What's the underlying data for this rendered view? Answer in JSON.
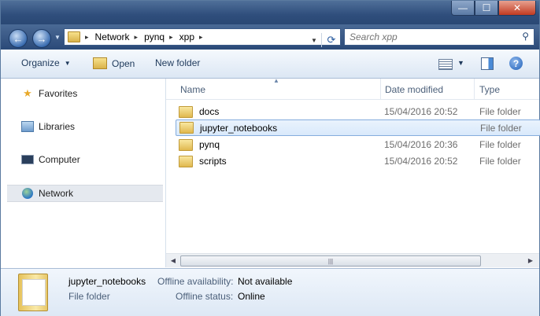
{
  "window": {
    "min_glyph": "—",
    "max_glyph": "☐",
    "close_glyph": "✕"
  },
  "address": {
    "crumbs": [
      "Network",
      "pynq",
      "xpp"
    ],
    "sep_glyph": "▸",
    "refresh_glyph": "⟳",
    "dropdown_glyph": "▼"
  },
  "search": {
    "placeholder": "Search xpp"
  },
  "toolbar": {
    "organize_label": "Organize",
    "open_label": "Open",
    "new_folder_label": "New folder",
    "dd_glyph": "▼",
    "help_glyph": "?"
  },
  "sidebar": {
    "items": [
      {
        "label": "Favorites",
        "icon": "star-icon"
      },
      {
        "label": "Libraries",
        "icon": "libraries-icon"
      },
      {
        "label": "Computer",
        "icon": "computer-icon"
      },
      {
        "label": "Network",
        "icon": "network-icon",
        "selected": true
      }
    ]
  },
  "columns": {
    "name": "Name",
    "date": "Date modified",
    "type": "Type",
    "sort_glyph": "▲"
  },
  "files": [
    {
      "name": "docs",
      "date": "15/04/2016 20:52",
      "type": "File folder"
    },
    {
      "name": "jupyter_notebooks",
      "date": "",
      "type": "File folder",
      "selected": true
    },
    {
      "name": "pynq",
      "date": "15/04/2016 20:36",
      "type": "File folder"
    },
    {
      "name": "scripts",
      "date": "15/04/2016 20:52",
      "type": "File folder"
    }
  ],
  "scrollbar": {
    "left_glyph": "◀",
    "right_glyph": "▶",
    "grip_glyph": "|||"
  },
  "details": {
    "name": "jupyter_notebooks",
    "type": "File folder",
    "offline_availability_label": "Offline availability:",
    "offline_availability_value": "Not available",
    "offline_status_label": "Offline status:",
    "offline_status_value": "Online"
  },
  "colors": {
    "title_bar": "#2f4e7c",
    "selection": "#d9e9fb",
    "selection_border": "#84acdd"
  }
}
